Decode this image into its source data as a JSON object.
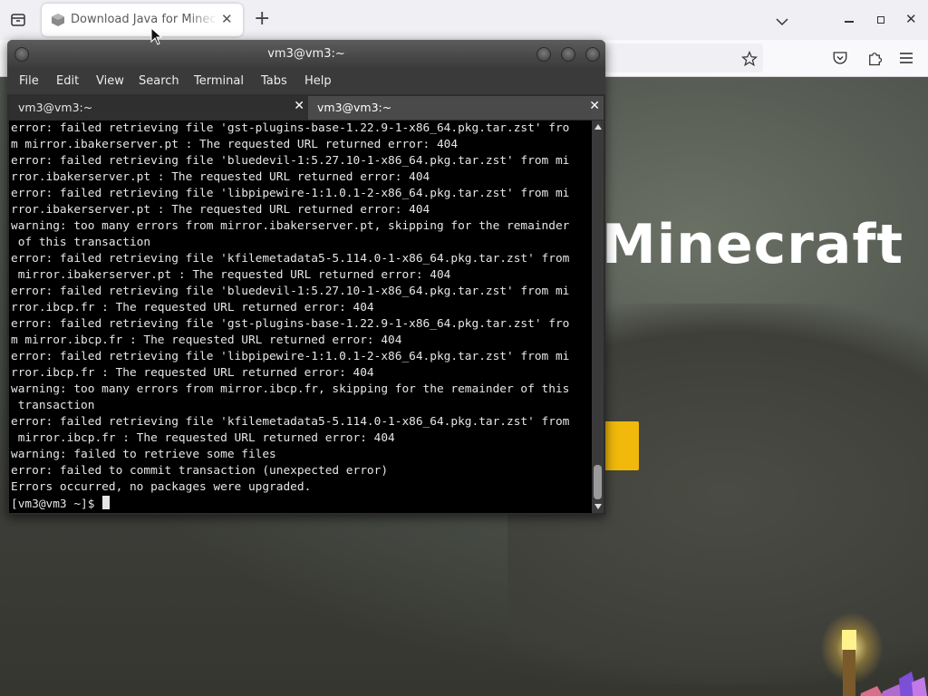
{
  "browser": {
    "tab": {
      "title": "Download Java for Minecraft"
    },
    "hero": {
      "title": "Minecraft"
    },
    "colors": {
      "accent": "#f0b90b"
    }
  },
  "terminal": {
    "title": "vm3@vm3:~",
    "menu": [
      "File",
      "Edit",
      "View",
      "Search",
      "Terminal",
      "Tabs",
      "Help"
    ],
    "tabs": [
      {
        "label": "vm3@vm3:~"
      },
      {
        "label": "vm3@vm3:~"
      }
    ],
    "lines": [
      "error: failed retrieving file 'gst-plugins-base-1.22.9-1-x86_64.pkg.tar.zst' fro",
      "m mirror.ibakerserver.pt : The requested URL returned error: 404",
      "error: failed retrieving file 'bluedevil-1:5.27.10-1-x86_64.pkg.tar.zst' from mi",
      "rror.ibakerserver.pt : The requested URL returned error: 404",
      "error: failed retrieving file 'libpipewire-1:1.0.1-2-x86_64.pkg.tar.zst' from mi",
      "rror.ibakerserver.pt : The requested URL returned error: 404",
      "warning: too many errors from mirror.ibakerserver.pt, skipping for the remainder",
      " of this transaction",
      "error: failed retrieving file 'kfilemetadata5-5.114.0-1-x86_64.pkg.tar.zst' from",
      " mirror.ibakerserver.pt : The requested URL returned error: 404",
      "error: failed retrieving file 'bluedevil-1:5.27.10-1-x86_64.pkg.tar.zst' from mi",
      "rror.ibcp.fr : The requested URL returned error: 404",
      "error: failed retrieving file 'gst-plugins-base-1.22.9-1-x86_64.pkg.tar.zst' fro",
      "m mirror.ibcp.fr : The requested URL returned error: 404",
      "error: failed retrieving file 'libpipewire-1:1.0.1-2-x86_64.pkg.tar.zst' from mi",
      "rror.ibcp.fr : The requested URL returned error: 404",
      "warning: too many errors from mirror.ibcp.fr, skipping for the remainder of this",
      " transaction",
      "error: failed retrieving file 'kfilemetadata5-5.114.0-1-x86_64.pkg.tar.zst' from",
      " mirror.ibcp.fr : The requested URL returned error: 404",
      "warning: failed to retrieve some files",
      "error: failed to commit transaction (unexpected error)",
      "Errors occurred, no packages were upgraded.",
      "[vm3@vm3 ~]$ "
    ]
  }
}
